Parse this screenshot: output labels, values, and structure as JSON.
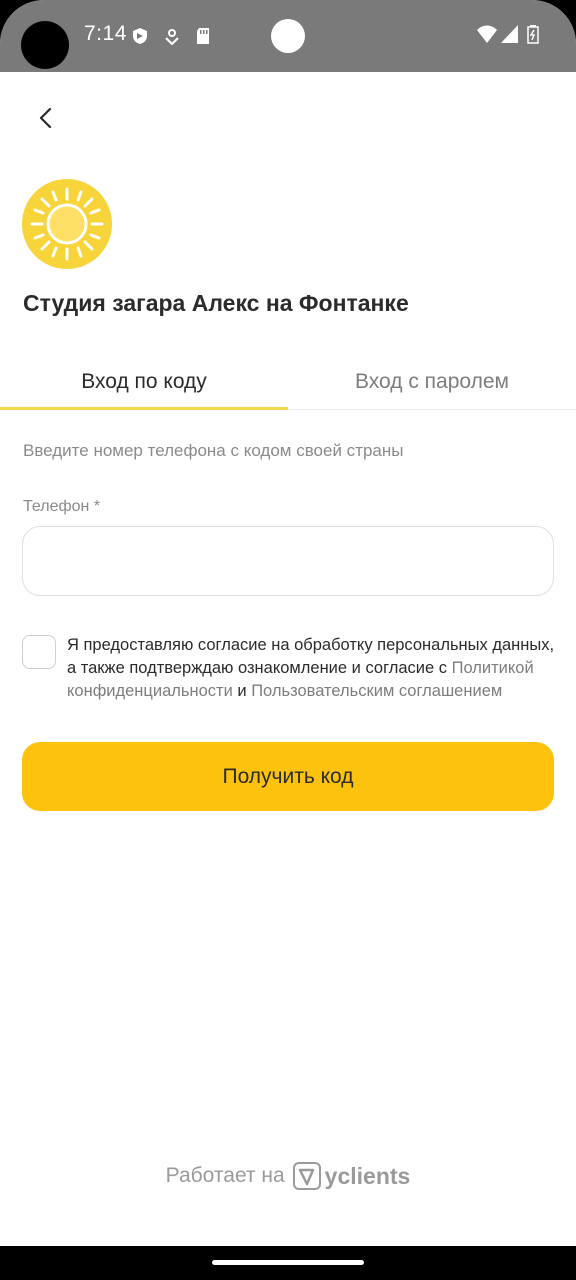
{
  "status_bar": {
    "time": "7:14"
  },
  "header": {
    "back_icon": "chevron-left-icon",
    "studio_name": "Студия загара Алекс на Фонтанке",
    "logo_icon": "sun-icon"
  },
  "tabs": [
    {
      "label": "Вход по коду",
      "active": true
    },
    {
      "label": "Вход с паролем",
      "active": false
    }
  ],
  "form": {
    "hint": "Введите номер телефона с кодом своей страны",
    "phone_label": "Телефон *",
    "phone_value": "",
    "consent_text_1": "Я предоставляю согласие на обработку персональных данных, а также подтверждаю ознакомление и согласие с ",
    "privacy_link": "Политикой конфиденциальности",
    "and": " и ",
    "agreement_link": "Пользовательским соглашением",
    "consent_checked": false,
    "submit_label": "Получить код"
  },
  "footer": {
    "powered_by": "Работает на",
    "brand": "yclients"
  },
  "colors": {
    "accent": "#fdc20d",
    "tab_underline": "#f5d74a",
    "logo_bg": "#f6d43a"
  }
}
